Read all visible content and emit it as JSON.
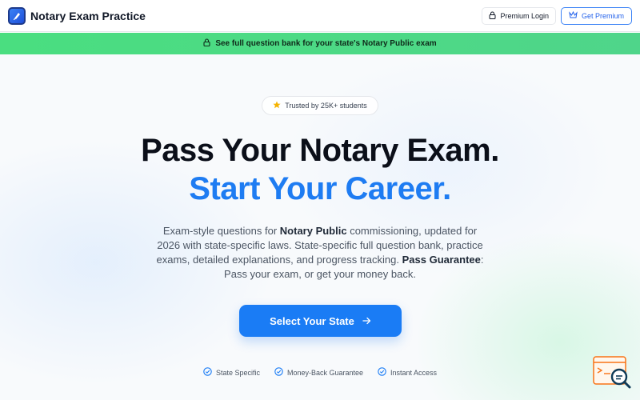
{
  "header": {
    "brand_title": "Notary Exam Practice",
    "login_label": "Premium Login",
    "premium_label": "Get Premium"
  },
  "banner": {
    "text": "See full question bank for your state's Notary Public exam"
  },
  "hero": {
    "trust_badge": "Trusted by 25K+ students",
    "title_line1": "Pass Your Notary Exam.",
    "title_line2": "Start Your Career.",
    "description": {
      "part1": "Exam-style questions for ",
      "bold1": "Notary Public",
      "part2": " commissioning, updated for 2026 with state-specific laws. State-specific full question bank, practice exams, detailed explanations, and progress tracking. ",
      "bold2": "Pass Guarantee",
      "part3": ": Pass your exam, or get your money back."
    },
    "cta_label": "Select Your State"
  },
  "features": [
    {
      "label": "State Specific"
    },
    {
      "label": "Money-Back Guarantee"
    },
    {
      "label": "Instant Access"
    }
  ],
  "colors": {
    "accent": "#1a7cf5",
    "banner": "#4ade80",
    "title_accent": "#1e7cf2"
  },
  "icons": {
    "logo": "pen-nib-icon",
    "login": "lock-icon",
    "premium": "crown-icon",
    "banner": "lock-icon",
    "trust": "star-icon",
    "cta": "arrow-right-icon",
    "feature": "check-circle-icon",
    "fab": "search-help-icon"
  }
}
